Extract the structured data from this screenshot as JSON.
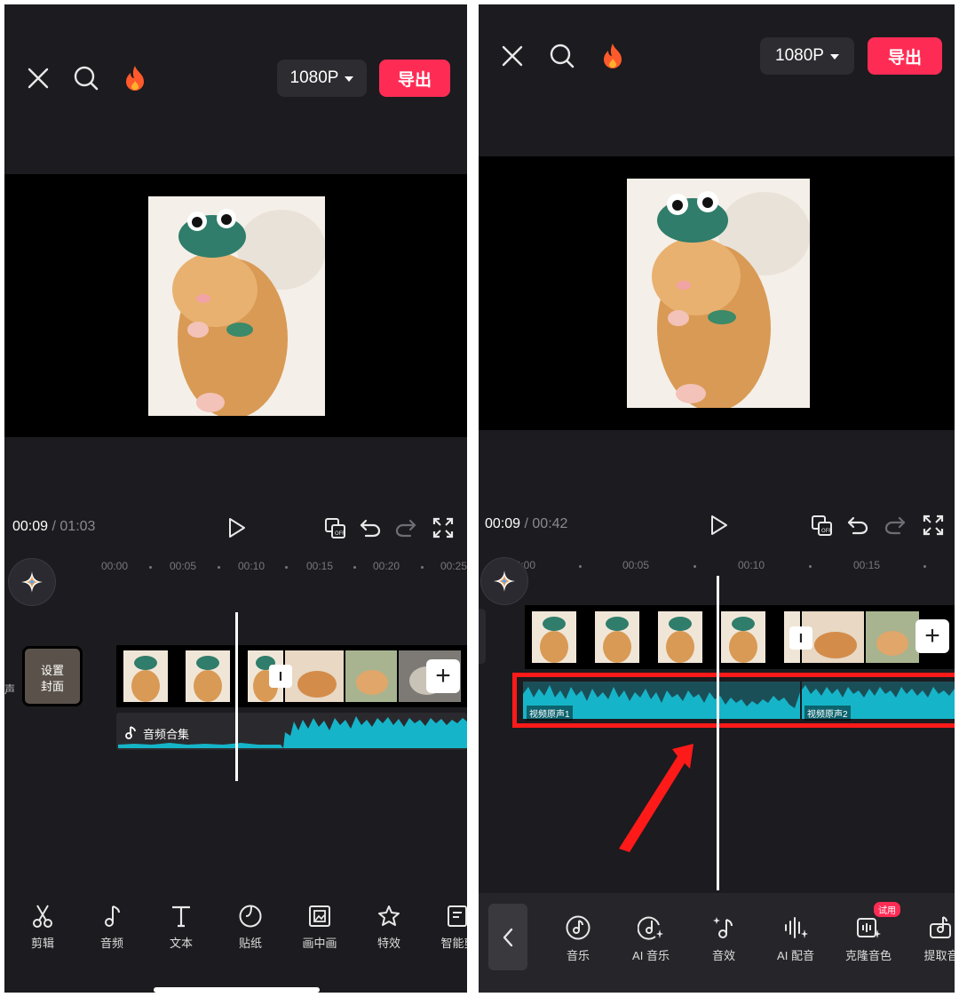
{
  "left": {
    "top_bar": {
      "resolution": "1080P",
      "export_label": "导出"
    },
    "playback": {
      "current_time": "00:09",
      "separator": "/",
      "total_time": "01:03"
    },
    "ruler": [
      "00:00",
      "00:05",
      "00:10",
      "00:15",
      "00:20",
      "00:25"
    ],
    "cover": {
      "line1": "设置",
      "line2": "封面"
    },
    "side_label": "声",
    "audio_track": {
      "label": "音频合集"
    },
    "toolbar": [
      {
        "label": "剪辑",
        "icon": "scissors-icon"
      },
      {
        "label": "音频",
        "icon": "music-note-icon"
      },
      {
        "label": "文本",
        "icon": "text-icon"
      },
      {
        "label": "贴纸",
        "icon": "sticker-icon"
      },
      {
        "label": "画中画",
        "icon": "picture-in-picture-icon"
      },
      {
        "label": "特效",
        "icon": "effects-star-icon"
      },
      {
        "label": "智能剪",
        "icon": "smart-edit-icon"
      }
    ]
  },
  "right": {
    "top_bar": {
      "resolution": "1080P",
      "export_label": "导出"
    },
    "playback": {
      "current_time": "00:09",
      "separator": "/",
      "total_time": "00:42"
    },
    "ruler": [
      "00:00",
      "00:05",
      "00:10",
      "00:15"
    ],
    "audio_segments": [
      {
        "label": "视频原声1"
      },
      {
        "label": "视频原声2"
      }
    ],
    "toolbar": [
      {
        "label": "音乐",
        "icon": "music-disc-icon"
      },
      {
        "label": "AI 音乐",
        "icon": "ai-music-icon"
      },
      {
        "label": "音效",
        "icon": "sound-effect-icon"
      },
      {
        "label": "AI 配音",
        "icon": "ai-voice-icon"
      },
      {
        "label": "克隆音色",
        "icon": "voice-clone-icon",
        "badge": "试用"
      },
      {
        "label": "提取音",
        "icon": "extract-audio-icon"
      }
    ]
  },
  "colors": {
    "accent": "#fe2c55",
    "waveform": "#16b4c8",
    "highlight": "#ff1a1a",
    "background": "#1c1b1f"
  }
}
